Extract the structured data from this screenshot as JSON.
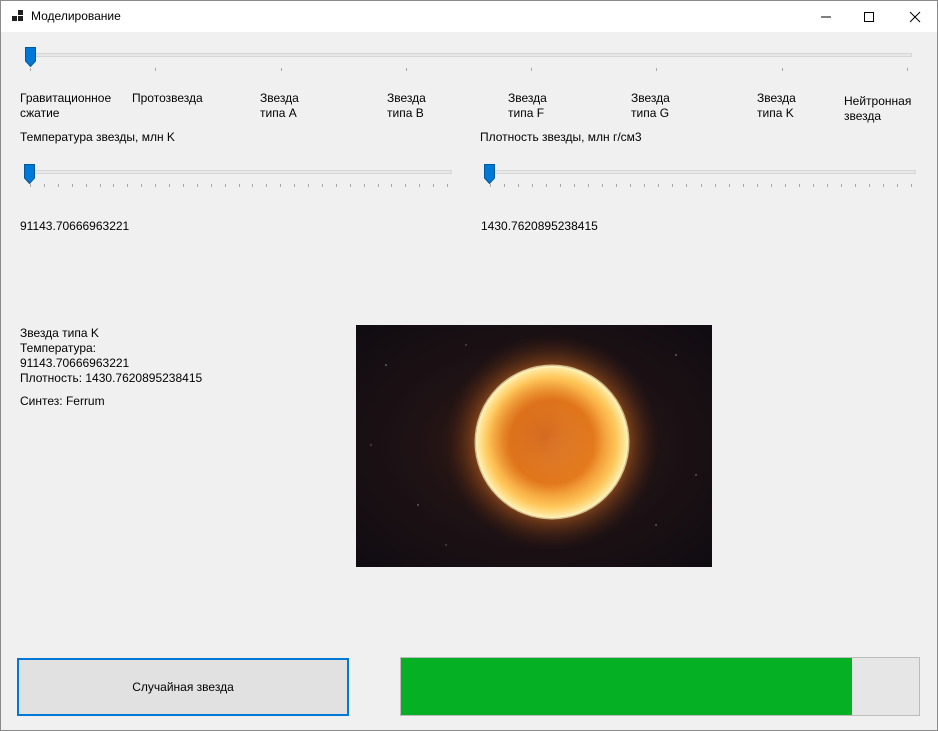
{
  "window": {
    "title": "Моделирование",
    "icons": {
      "app": "app-icon",
      "minimize": "minimize-icon",
      "maximize": "maximize-icon",
      "close": "close-icon"
    }
  },
  "evolution_slider": {
    "stages": [
      "Гравитационное\nсжатие",
      "Протозвезда",
      "Звезда\nтипа A",
      "Звезда\nтипа B",
      "Звезда\nтипа F",
      "Звезда\nтипа G",
      "Звезда\nтипа K",
      "Нейтронная\nзвезда"
    ],
    "selected_index": 0
  },
  "temperature": {
    "caption": "Температура звезды, млн K",
    "value": "91143.70666963221",
    "slider_position": 0
  },
  "density": {
    "caption": "Плотность звезды, млн г/см3",
    "value": "1430.7620895238415",
    "slider_position": 0
  },
  "info": {
    "star_type": "Звезда типа K",
    "temperature_label": "Температура:",
    "temperature_value": "91143.70666963221",
    "density_line": "Плотность: 1430.7620895238415",
    "synthesis_line": "Синтез: Ferrum"
  },
  "image": {
    "subject": "star-photo"
  },
  "random_button": {
    "label": "Случайная звезда"
  },
  "progress": {
    "fraction": 0.87,
    "fill_color": "#06b025"
  },
  "colors": {
    "accent": "#0078d7",
    "background": "#f0f0f0"
  }
}
